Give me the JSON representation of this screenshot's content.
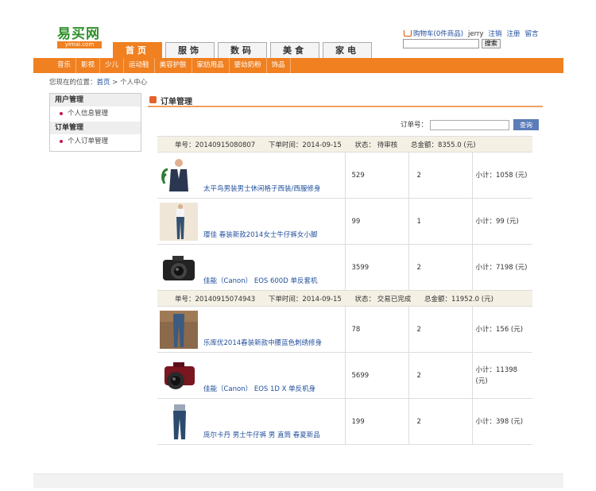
{
  "logo": {
    "cn": "易买网",
    "en": "yimai.com"
  },
  "top": {
    "cart": "购物车(0件商品)",
    "user": "jerry",
    "logout": "注销",
    "register": "注册",
    "message": "留言",
    "search_button": "搜索"
  },
  "tabs": [
    "首页",
    "服饰",
    "数码",
    "美食",
    "家电"
  ],
  "categories": [
    "音乐",
    "影视",
    "少儿",
    "运动鞋",
    "美容护肤",
    "家纺用品",
    "婴幼奶粉",
    "饰品"
  ],
  "breadcrumb": {
    "prefix": "您现在的位置：",
    "home": "首页",
    "sep": " > ",
    "current": "个人中心"
  },
  "sidebar": {
    "user_mgmt": "用户管理",
    "user_info": "个人信息管理",
    "order_mgmt": "订单管理",
    "my_orders": "个人订单管理"
  },
  "section_title": "订单管理",
  "search": {
    "label": "订单号：",
    "button": "查询"
  },
  "orders": [
    {
      "order_no": "单号：20140915080807",
      "time": "下单时间：2014-09-15",
      "status": "状态：  待审核",
      "total": "总金额：8355.0 (元)",
      "items": [
        {
          "name": "太平鸟男装男士休闲格子西装/西服修身",
          "price": "529",
          "qty": "2",
          "subtotal": "小计：1058 (元)"
        },
        {
          "name": "璎佳 春装新款2014女士牛仔裤女小脚",
          "price": "99",
          "qty": "1",
          "subtotal": "小计：99 (元)"
        },
        {
          "name": "佳能（Canon） EOS 600D 单反套机",
          "price": "3599",
          "qty": "2",
          "subtotal": "小计：7198 (元)"
        }
      ]
    },
    {
      "order_no": "单号：20140915074943",
      "time": "下单时间：2014-09-15",
      "status": "状态：  交易已完成",
      "total": "总金额：11952.0 (元)",
      "items": [
        {
          "name": "乐库优2014春装新款中腰蓝色刺绣修身",
          "price": "78",
          "qty": "2",
          "subtotal": "小计：156 (元)"
        },
        {
          "name": "佳能（Canon） EOS 1D X 单反机身",
          "price": "5699",
          "qty": "2",
          "subtotal": "小计：11398 (元)"
        },
        {
          "name": "庞尔卡丹 男士牛仔裤 男 直筒 春夏新品",
          "price": "199",
          "qty": "2",
          "subtotal": "小计：398 (元)"
        }
      ]
    }
  ]
}
